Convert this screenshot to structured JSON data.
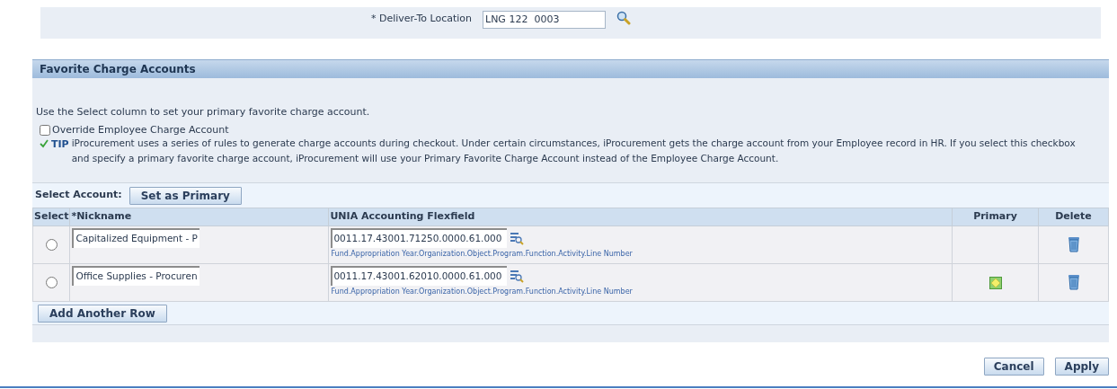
{
  "deliver_to": {
    "label": "* Deliver-To Location",
    "value": "LNG 122  0003"
  },
  "section": {
    "title": "Favorite Charge Accounts",
    "instruction": "Use the Select column to set your primary favorite charge account.",
    "override": {
      "label": "Override Employee Charge Account",
      "checked": false
    },
    "tip": {
      "label": "TIP",
      "text": "iProcurement uses a series of rules to generate charge accounts during checkout. Under certain circumstances, iProcurement gets the charge account from your Employee record in HR. If you select this checkbox and specify a primary favorite charge account, iProcurement will use your Primary Favorite Charge Account instead of the Employee Charge Account."
    }
  },
  "select_account": {
    "label": "Select Account:",
    "button": "Set as Primary"
  },
  "table": {
    "columns": [
      "Select",
      "*Nickname",
      "UNIA Accounting Flexfield",
      "Primary",
      "Delete"
    ],
    "rows": [
      {
        "selected": false,
        "nickname": "Capitalized Equipment - P",
        "flexfield": "0011.17.43001.71250.0000.61.000",
        "hint": "Fund.Appropriation Year.Organization.Object.Program.Function.Activity.Line Number",
        "primary": false
      },
      {
        "selected": false,
        "nickname": "Office Supplies - Procuren",
        "flexfield": "0011.17.43001.62010.0000.61.000",
        "hint": "Fund.Appropriation Year.Organization.Object.Program.Function.Activity.Line Number",
        "primary": true
      }
    ]
  },
  "add_row_button": "Add Another Row",
  "buttons": [
    "Cancel",
    "Apply"
  ]
}
